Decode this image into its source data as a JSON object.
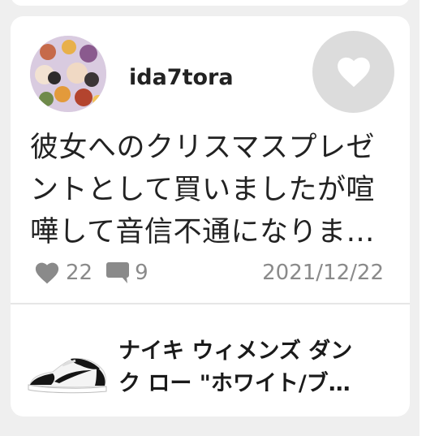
{
  "post": {
    "username": "ida7tora",
    "text_lines": [
      "彼女へのクリスマスプレゼ",
      "ントとして買いましたが喧",
      "嘩して音信不通になりま…"
    ],
    "like_count": "22",
    "comment_count": "9",
    "date": "2021/12/22",
    "like_button_icon": "heart-icon"
  },
  "product": {
    "name_lines": [
      "ナイキ ウィメンズ ダン",
      "ク ロー \"ホワイト/ブ…"
    ],
    "image_icon": "sneaker-image"
  },
  "colors": {
    "background": "#efefef",
    "card": "#ffffff",
    "like_button_bg": "#dcdcdc",
    "muted_text": "#8a8a8a"
  }
}
